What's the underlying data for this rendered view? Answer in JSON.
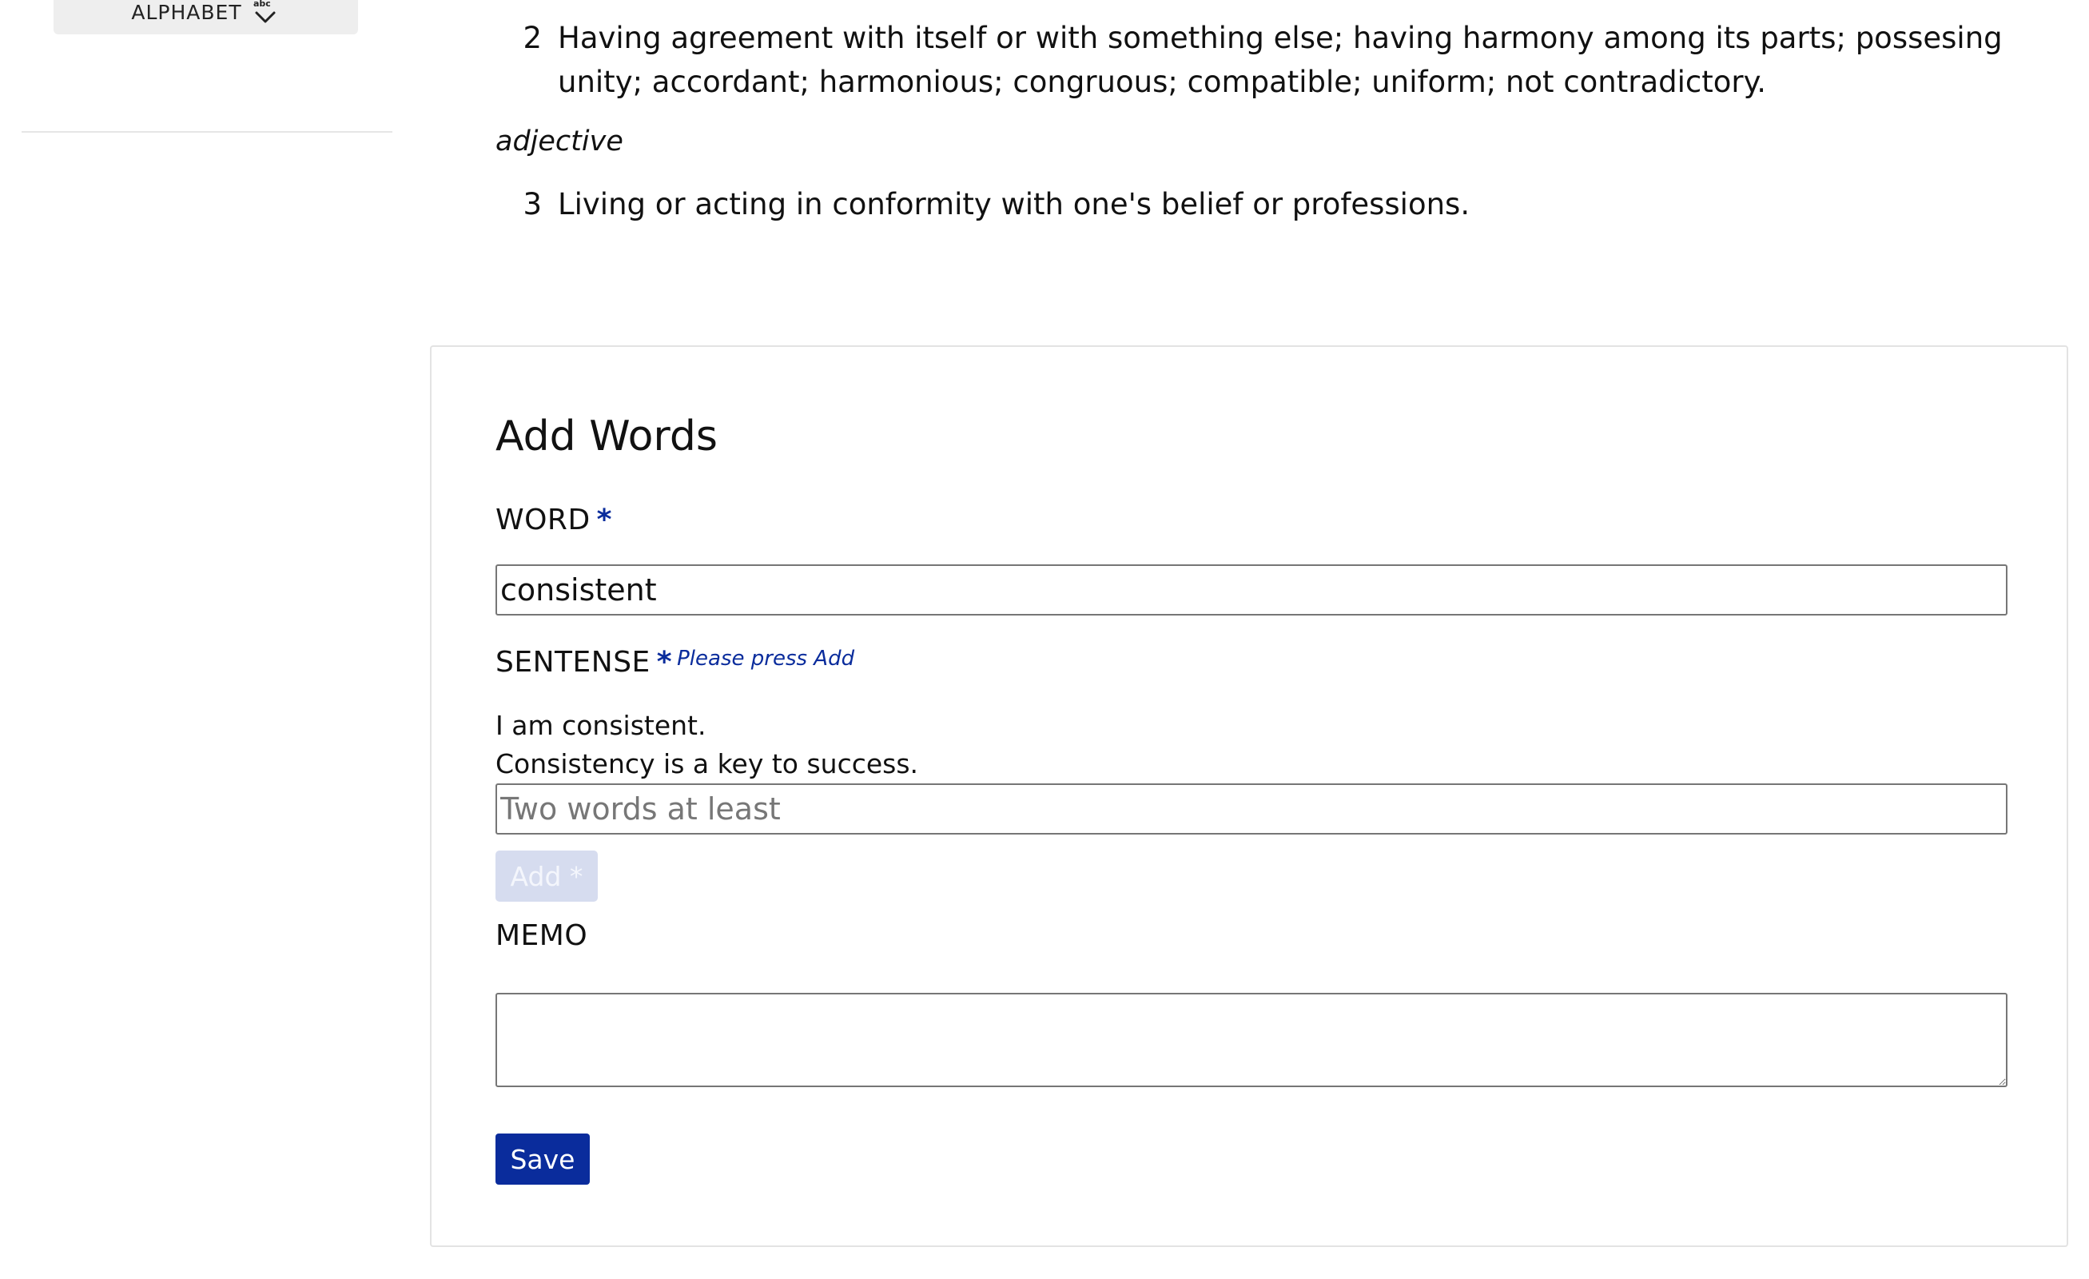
{
  "sidebar": {
    "alphabet_button": {
      "label": "ALPHABET",
      "icon": "sort-alpha-down-icon"
    }
  },
  "definitions": [
    {
      "number": "2",
      "text": "Having agreement with itself or with something else; having harmony among its parts; possesing unity; accordant; harmonious; congruous; compatible; uniform; not contradictory."
    },
    {
      "part_of_speech": "adjective"
    },
    {
      "number": "3",
      "text": "Living or acting in conformity with one's belief or professions."
    }
  ],
  "form": {
    "title": "Add Words",
    "word": {
      "label": "WORD",
      "required_mark": "*",
      "value": "consistent"
    },
    "sentence": {
      "label": "SENTENSE",
      "required_mark": "*",
      "hint": "Please press Add",
      "items": [
        "I am consistent.",
        "Consistency is a key to success."
      ],
      "placeholder": "Two words at least",
      "add_button": "Add *"
    },
    "memo": {
      "label": "MEMO",
      "value": ""
    },
    "save_button": "Save"
  },
  "colors": {
    "primary": "#0a2c9c",
    "disabled_button": "#d6dcef",
    "sidebar_button_bg": "#eeeeee",
    "border": "#767676"
  }
}
